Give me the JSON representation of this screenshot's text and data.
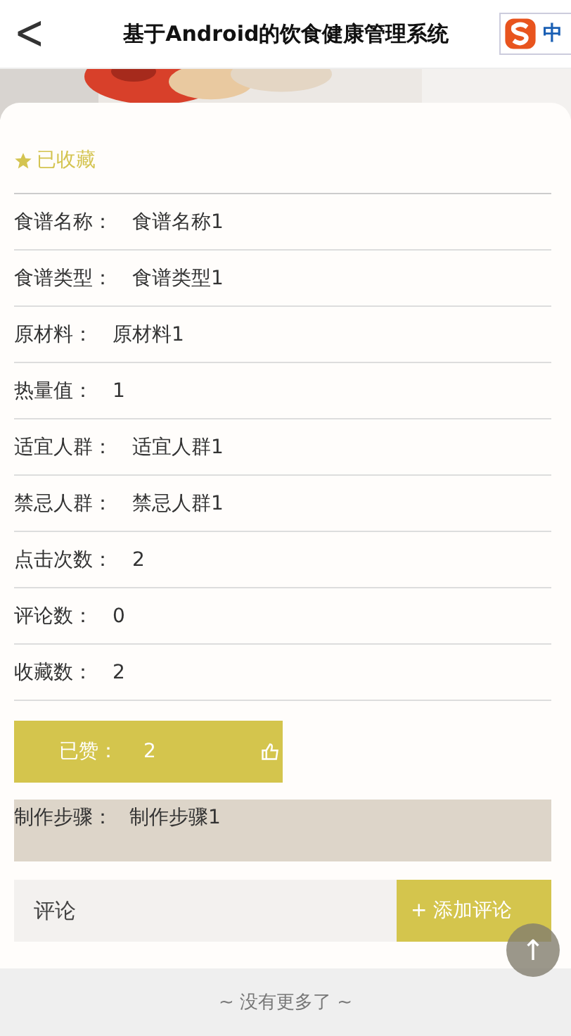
{
  "header": {
    "back": "<",
    "title": "基于Android的饮食健康管理系统",
    "ime_label": "中"
  },
  "favorite": {
    "label": "已收藏",
    "selected": true
  },
  "fields": [
    {
      "label": "食谱名称：",
      "value": "食谱名称1"
    },
    {
      "label": "食谱类型：",
      "value": "食谱类型1"
    },
    {
      "label": "原材料：",
      "value": "原材料1"
    },
    {
      "label": "热量值：",
      "value": "1"
    },
    {
      "label": "适宜人群：",
      "value": "适宜人群1"
    },
    {
      "label": "禁忌人群：",
      "value": "禁忌人群1"
    },
    {
      "label": "点击次数：",
      "value": "2"
    },
    {
      "label": "评论数：",
      "value": "0"
    },
    {
      "label": "收藏数：",
      "value": "2"
    }
  ],
  "like": {
    "label": "已赞：",
    "count": "2",
    "selected": true
  },
  "steps": {
    "label": "制作步骤：",
    "value": "制作步骤1"
  },
  "comment": {
    "placeholder": "评论",
    "button": "+ 添加评论"
  },
  "scroll_top": "↑",
  "footer": "~ 没有更多了 ~"
}
